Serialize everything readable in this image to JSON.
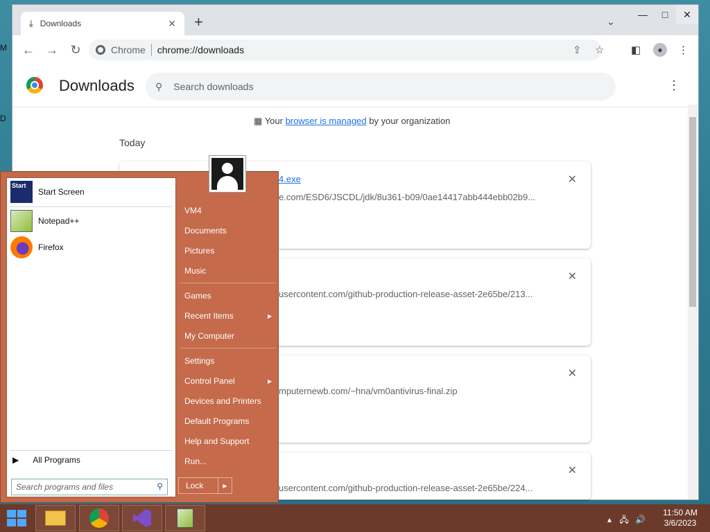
{
  "desktop": {
    "edge_text_1": "M",
    "edge_text_2": "D"
  },
  "window": {
    "minimize": "—",
    "maximize": "□",
    "close": "✕"
  },
  "tab": {
    "title": "Downloads",
    "close": "✕",
    "new_tab": "+",
    "tab_search": "⌄"
  },
  "toolbar": {
    "back": "←",
    "forward": "→",
    "reload": "↻",
    "omnibox_label": "Chrome",
    "url": "chrome://downloads"
  },
  "downloads": {
    "title": "Downloads",
    "search_placeholder": "Search downloads",
    "managed_prefix": "Your ",
    "managed_link": "browser is managed",
    "managed_suffix": " by your organization",
    "section": "Today",
    "items": [
      {
        "file": "4.exe",
        "url": "e.com/ESD6/JSCDL/jdk/8u361-b09/0ae14417abb444ebb02b9..."
      },
      {
        "file": "",
        "url": "usercontent.com/github-production-release-asset-2e65be/213..."
      },
      {
        "file": "",
        "url": "mputernewb.com/~hna/vm0antivirus-final.zip"
      },
      {
        "file": "",
        "url": "usercontent.com/github-production-release-asset-2e65be/224..."
      }
    ]
  },
  "start_menu": {
    "pinned": [
      {
        "label": "Start Screen",
        "icon_text": "Start"
      },
      {
        "label": "Notepad++"
      },
      {
        "label": "Firefox"
      }
    ],
    "all_programs": "All Programs",
    "search_placeholder": "Search programs and files",
    "right_items": [
      "VM4",
      "Documents",
      "Pictures",
      "Music",
      "Games",
      "Recent Items",
      "My Computer",
      "Settings",
      "Control Panel",
      "Devices and Printers",
      "Default Programs",
      "Help and Support",
      "Run..."
    ],
    "lock": "Lock"
  },
  "taskbar": {
    "time": "11:50 AM",
    "date": "3/6/2023"
  }
}
